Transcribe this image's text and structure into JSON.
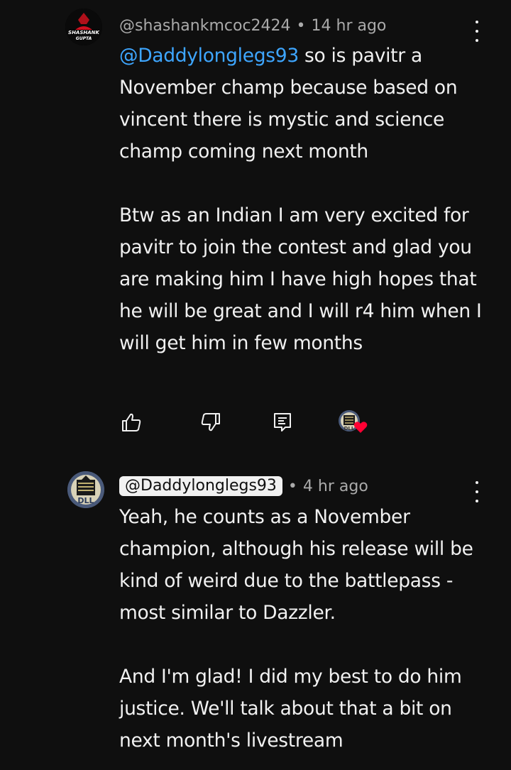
{
  "comments": [
    {
      "author": "@shashankmcoc2424",
      "time": "14 hr ago",
      "mention": "@Daddylonglegs93",
      "para1": " so is pavitr a November champ because based on vincent there is mystic and science champ coming next month",
      "para2": "Btw as an Indian I am very excited for pavitr to join the contest and glad you are making him I have high hopes that he will be great and I will r4 him when I will get him in few months",
      "avatar_text": "SHASHANK GUPTA",
      "actions": {
        "like_icon": "thumbs-up-icon",
        "dislike_icon": "thumbs-down-icon",
        "reply_icon": "reply-icon",
        "creator_heart_icon": "heart-icon"
      }
    },
    {
      "author": "@Daddylonglegs93",
      "time": "4 hr ago",
      "para1": "Yeah, he counts as a November champion, although his release will be kind of weird due to the battlepass - most similar to Dazzler.",
      "para2": "And I'm glad! I did my best to do him justice. We'll talk about that a bit on next month's livestream",
      "avatar_text": "DLL"
    }
  ],
  "separator": "•",
  "colors": {
    "background": "#0f0f0f",
    "text": "#f1f1f1",
    "secondary": "#aaaaaa",
    "link": "#3ea6ff",
    "heart": "#ff0033"
  }
}
